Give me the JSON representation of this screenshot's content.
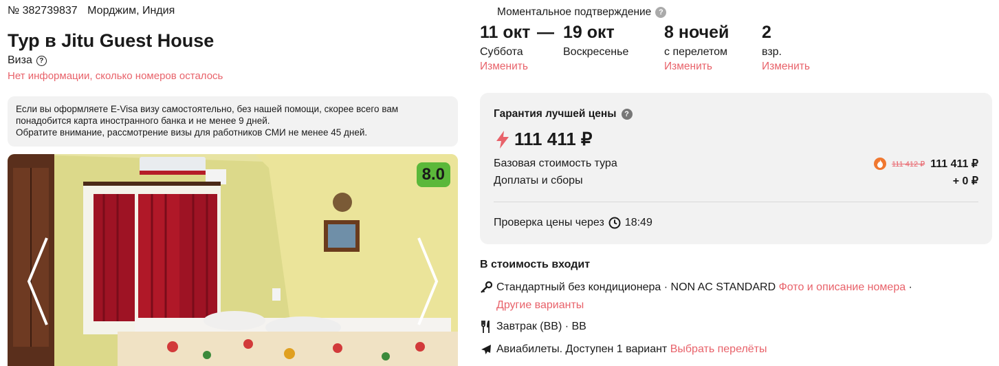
{
  "tour": {
    "number": "№ 382739837",
    "location": "Морджим, Индия",
    "title": "Тур в Jitu Guest House",
    "visa_label": "Виза",
    "rooms_left": "Нет информации, сколько номеров осталось",
    "visa_info_line1": "Если вы оформляете E-Visa визу самостоятельно, без нашей помощи, скорее всего вам понадобится карта иностранного банка и не менее 9 дней.",
    "visa_info_line2": "Обратите внимание, рассмотрение визы для работников СМИ не менее 45 дней."
  },
  "photo": {
    "rating": "8.0"
  },
  "booking": {
    "instant_confirm": "Моментальное подтверждение",
    "date_from": "11 окт",
    "date_from_day": "Суббота",
    "dash": "—",
    "date_to": "19 окт",
    "date_to_day": "Воскресенье",
    "nights": "8 ночей",
    "nights_sub": "с перелетом",
    "adults": "2",
    "adults_sub": "взр.",
    "change_label": "Изменить"
  },
  "price": {
    "guarantee": "Гарантия лучшей цены",
    "total": "111 411 ₽",
    "base_label": "Базовая стоимость тура",
    "base_old": "111 412 ₽",
    "base_value": "111 411 ₽",
    "fees_label": "Доплаты и сборы",
    "fees_value": "+ 0 ₽",
    "check_label": "Проверка цены через",
    "check_timer": "18:49"
  },
  "included": {
    "title": "В стоимость входит",
    "room_text": "Стандартный без кондиционера · NON AC STANDARD",
    "room_link": "Фото и описание номера",
    "room_sep": " ·",
    "room_other": "Другие варианты",
    "meal_text": "Завтрак (BB) · BB",
    "flight_text": "Авиабилеты. Доступен 1 вариант",
    "flight_link": "Выбрать перелёты"
  },
  "colors": {
    "accent": "#e8626a",
    "rating_bg": "#5bb83a",
    "panel_bg": "#f2f2f2",
    "fire": "#f07830"
  }
}
